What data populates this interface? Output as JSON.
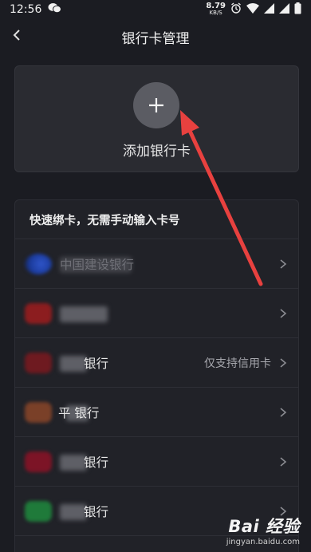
{
  "status": {
    "time": "12:56",
    "speed_value": "8.79",
    "speed_unit": "KB/S"
  },
  "nav": {
    "title": "银行卡管理"
  },
  "add_card": {
    "label": "添加银行卡"
  },
  "quick_bind": {
    "title": "快速绑卡，无需手动输入卡号"
  },
  "banks": [
    {
      "name": "中国建设银行",
      "note": ""
    },
    {
      "name": "",
      "note": ""
    },
    {
      "name": "银行",
      "note": "仅支持信用卡"
    },
    {
      "name": "平 银行",
      "note": ""
    },
    {
      "name": "银行",
      "note": ""
    },
    {
      "name": "银行",
      "note": ""
    }
  ],
  "watermark": {
    "logo": "Bai 经验",
    "url": "jingyan.baidu.com"
  },
  "colors": {
    "background": "#1b1c22",
    "card": "#2a2b31",
    "arrow": "#e8413f"
  }
}
